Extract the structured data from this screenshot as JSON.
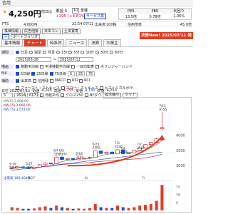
{
  "header": {
    "label": "信用"
  },
  "quote": {
    "price": "4,250円",
    "prev_label": "前日比",
    "market": "東証 S",
    "tag": "10",
    "sector_label": "業種",
    "change": "+195 (+4.81%)",
    "service_label": "サービス業",
    "pts_label": "PTS",
    "pts_price": "4,000円",
    "time": "22:54",
    "date": "07/11",
    "volume_label": "出来高",
    "volume": "100株",
    "per_label": "PER",
    "pbr_label": "PBR",
    "yield_label": "利回り",
    "per": "13.5倍",
    "pbr": "0.78倍",
    "yield": "1.06%",
    "credit_ratio_label": "信用倍率",
    "credit_ratio": "45.0倍"
  },
  "buttons": {
    "stock_info": "株価情報",
    "chart_ai": "広告他掛",
    "nikkei": "日本コン",
    "theme": "土本賞寄",
    "add": "+",
    "watch": "ポートフォリオ",
    "news_sticker": "決算New! 2025/07/11 発表"
  },
  "tabs": [
    "基本情報",
    "チャート",
    "時系列",
    "ニュース",
    "決算",
    "大株主"
  ],
  "settings": {
    "period_label": "期間",
    "periods": [
      "日足",
      "週足",
      "月足",
      "1分",
      "5分",
      "10分",
      "30分",
      "60分"
    ],
    "date_from": "2025/05/16",
    "date_to": "2025/07/11",
    "draw_label": "描画",
    "draw_options": [
      "移動平均線",
      "平滑移動平均線",
      "一目均衡表",
      "ボリンジャーバンド"
    ],
    "ma_label": "MA",
    "ma_lines": [
      "5日線",
      "25日線",
      "75日線"
    ],
    "ma_values": [
      "5",
      "25",
      "75"
    ],
    "sub_label": "補助",
    "sub_options": [
      "出来高",
      "信用残",
      "MACD",
      "RSI",
      "RCI"
    ],
    "fast_label": "ファースト・ストキャス",
    "slow_label": "スロー・ストキャス",
    "hist_label": "ヒストリカルボラ"
  },
  "chart_toolbar": {
    "date": "日付 2025/07/11",
    "open_label": "始値",
    "open": "4,205",
    "high_label": "高値",
    "high": "4,755",
    "low_label": "安値",
    "low": "4,150",
    "close_label": "終値",
    "close": "4,250",
    "ma_inputs": [
      "5",
      "261A",
      "6171"
    ],
    "log_label": "日経平均",
    "cross_label": "クロス250",
    "ny_label": "NYダウ",
    "zoom_btn": "拡大縮小",
    "clear_btn": "クリア"
  },
  "chart_data": {
    "type": "candlestick",
    "ma_legend": [
      {
        "name": "MA(5)",
        "value": "3,908.00",
        "color": "#2e7d32"
      },
      {
        "name": "MA(25)",
        "value": "3,666.00",
        "color": "#d0021b"
      },
      {
        "name": "MA(75)",
        "value": "3,574.00",
        "color": "#1a4bd1"
      }
    ],
    "y_ticks": [
      "4000",
      "3500",
      "3000"
    ],
    "x_ticks": [
      "5/27",
      "6/",
      "7/"
    ],
    "annotations": [
      {
        "label": "7/11",
        "price": "4755"
      },
      {
        "label": "6/23",
        "price": "3505"
      },
      {
        "label": "7/3",
        "price": "3540"
      },
      {
        "label": "6/4",
        "price": "3300"
      },
      {
        "label": "6/5",
        "price": "3300"
      },
      {
        "label": "6/18",
        "price": "3195"
      },
      {
        "label": "7/4",
        "price": "3370"
      },
      {
        "label": "5/18",
        "price": "2850"
      },
      {
        "label": "5/27",
        "price": "2860"
      },
      {
        "label": "7/7",
        "price": "3500"
      }
    ],
    "candles": [
      [
        2900,
        2950,
        2850,
        2930
      ],
      [
        2930,
        2980,
        2900,
        2960
      ],
      [
        2960,
        3000,
        2920,
        2940
      ],
      [
        2940,
        2970,
        2880,
        2900
      ],
      [
        2900,
        2960,
        2870,
        2950
      ],
      [
        2950,
        3050,
        2940,
        3030
      ],
      [
        3030,
        3100,
        3000,
        3080
      ],
      [
        3080,
        3120,
        3040,
        3060
      ],
      [
        3060,
        3300,
        3050,
        3280
      ],
      [
        3280,
        3320,
        3180,
        3200
      ],
      [
        3200,
        3260,
        3150,
        3230
      ],
      [
        3230,
        3250,
        3170,
        3190
      ],
      [
        3190,
        3240,
        3180,
        3220
      ],
      [
        3220,
        3260,
        3200,
        3250
      ],
      [
        3250,
        3300,
        3220,
        3270
      ],
      [
        3270,
        3505,
        3260,
        3480
      ],
      [
        3480,
        3500,
        3380,
        3400
      ],
      [
        3400,
        3460,
        3380,
        3440
      ],
      [
        3440,
        3480,
        3370,
        3390
      ],
      [
        3390,
        3540,
        3380,
        3520
      ],
      [
        3520,
        3530,
        3370,
        3390
      ],
      [
        3390,
        3420,
        3380,
        3410
      ],
      [
        3410,
        3520,
        3400,
        3500
      ],
      [
        3500,
        3600,
        3480,
        3580
      ],
      [
        3580,
        3700,
        3560,
        3690
      ],
      [
        3690,
        3780,
        3650,
        3760
      ],
      [
        3760,
        3900,
        3740,
        3880
      ],
      [
        4205,
        4755,
        4150,
        4250
      ]
    ],
    "volume_label": "出来高",
    "volume_value": "188,400株",
    "volume_ticks": [
      "15",
      "10",
      "5"
    ],
    "volumes": [
      2,
      1.5,
      1,
      1,
      1.2,
      2,
      2.5,
      1.5,
      3,
      2,
      1.5,
      1,
      1.2,
      1,
      1.5,
      4,
      2,
      1.5,
      1.5,
      3,
      2,
      1.5,
      2,
      3,
      3.5,
      4,
      6,
      16
    ]
  }
}
